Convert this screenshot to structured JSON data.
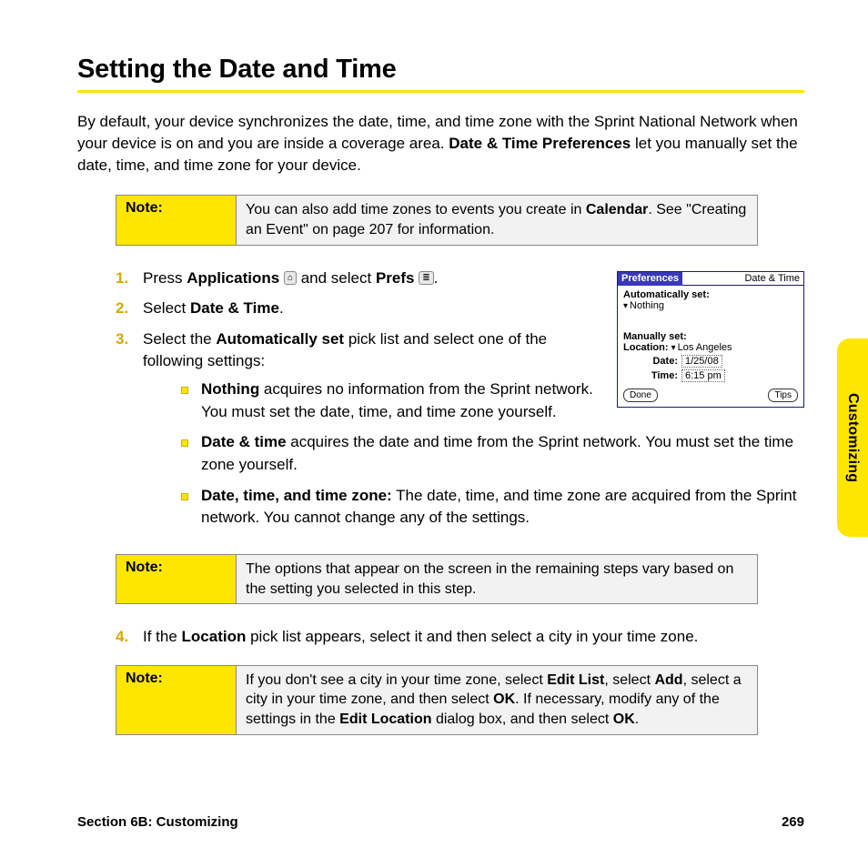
{
  "heading": "Setting the Date and Time",
  "intro": {
    "pre": "By default, your device synchronizes the date, time, and time zone with the Sprint National Network when your device is on and you are inside a coverage area. ",
    "bold": "Date & Time Preferences",
    "post": " let you manually set the date, time, and time zone for your device."
  },
  "notes": {
    "label": "Note:",
    "n1": {
      "pre": "You can also add time zones to events you create in ",
      "bold": "Calendar",
      "post": ". See \"Creating an Event\" on page 207 for information."
    },
    "n2": "The options that appear on the screen in the remaining steps vary based on the setting you selected in this step.",
    "n3": {
      "p1": "If you don't see a city in your time zone, select ",
      "b1": "Edit List",
      "p2": ", select ",
      "b2": "Add",
      "p3": ", select a city in your time zone, and then select ",
      "b3": "OK",
      "p4": ". If necessary, modify any of the settings in the ",
      "b4": "Edit Location",
      "p5": " dialog box, and then select ",
      "b5": "OK",
      "p6": "."
    }
  },
  "steps": {
    "s1": {
      "pre": "Press ",
      "b1": "Applications",
      "mid": " and select ",
      "b2": "Prefs",
      "post": "."
    },
    "s2": {
      "pre": "Select ",
      "b1": "Date & Time",
      "post": "."
    },
    "s3": {
      "pre": "Select the ",
      "b1": "Automatically set",
      "post": " pick list and select one of the following settings:"
    },
    "s4": {
      "pre": "If the ",
      "b1": "Location",
      "post": " pick list appears, select it and then select a city in your time zone."
    }
  },
  "bullets": {
    "b1": {
      "bold": "Nothing",
      "text": " acquires no information from the Sprint network. You must set the date, time, and time zone yourself."
    },
    "b2": {
      "bold": "Date & time",
      "text": " acquires the date and time from the Sprint network. You must set the time zone yourself."
    },
    "b3": {
      "bold": "Date, time, and time zone:",
      "text": " The date, time, and time zone are acquired from the Sprint network. You cannot change any of the settings."
    }
  },
  "screenshot": {
    "title_left": "Preferences",
    "title_right": "Date & Time",
    "auto_label": "Automatically set:",
    "auto_value": "Nothing",
    "manual_label": "Manually set:",
    "location_label": "Location:",
    "location_value": "Los Angeles",
    "date_label": "Date:",
    "date_value": "1/25/08",
    "time_label": "Time:",
    "time_value": "6:15 pm",
    "done": "Done",
    "tips": "Tips"
  },
  "icons": {
    "home": "⌂",
    "prefs": "≣"
  },
  "side_tab": "Customizing",
  "footer": {
    "section": "Section 6B: Customizing",
    "page": "269"
  }
}
